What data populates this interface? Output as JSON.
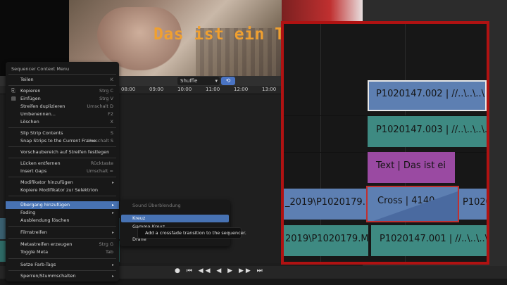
{
  "preview": {
    "overlay_text": "Das ist ein T"
  },
  "toolbar": {
    "snap_mode": "Shuffle"
  },
  "ruler": {
    "ticks": [
      "08:00",
      "09:00",
      "10:00",
      "11:00",
      "12:00",
      "13:00"
    ]
  },
  "context_menu": {
    "title": "Sequencer Context Menu",
    "items": [
      {
        "label": "Teilen",
        "shortcut": "K"
      },
      {
        "label": "Kopieren",
        "shortcut": "Strg C"
      },
      {
        "label": "Einfügen",
        "shortcut": "Strg V"
      },
      {
        "label": "Streifen duplizieren",
        "shortcut": "Umschalt D"
      },
      {
        "label": "Umbenennen...",
        "shortcut": "F2"
      },
      {
        "label": "Löschen",
        "shortcut": "X"
      },
      {
        "label": "Slip Strip Contents",
        "shortcut": "S"
      },
      {
        "label": "Snap Strips to the Current Frame",
        "shortcut": "Umschalt S"
      },
      {
        "label": "Vorschaubereich auf Streifen festlegen",
        "shortcut": ""
      },
      {
        "label": "Lücken entfernen",
        "shortcut": "Rücktaste"
      },
      {
        "label": "Insert Gaps",
        "shortcut": "Umschalt ="
      },
      {
        "label": "Modifikator hinzufügen",
        "shortcut": ""
      },
      {
        "label": "Kopiere Modifikator zur Selektrion",
        "shortcut": ""
      },
      {
        "label": "Übergang hinzufügen",
        "shortcut": ""
      },
      {
        "label": "Fading",
        "shortcut": ""
      },
      {
        "label": "Ausblendung löschen",
        "shortcut": ""
      },
      {
        "label": "Filmstreifen",
        "shortcut": ""
      },
      {
        "label": "Metastreifen erzeugen",
        "shortcut": "Strg G"
      },
      {
        "label": "Toggle Meta",
        "shortcut": "Tab"
      },
      {
        "label": "Setze Farb-Tags",
        "shortcut": ""
      },
      {
        "label": "Sperren/Stummschalten",
        "shortcut": ""
      }
    ]
  },
  "submenu": {
    "items": [
      "Sound Überblendung",
      "Kreuz",
      "Gamma Kreuz",
      "Drane"
    ]
  },
  "tooltip": "Add a crossfade transition to the sequencer.",
  "zoom": {
    "clips": [
      "P1020147.002 | //..\\..\\..\\..\\P",
      "P1020147.003 | //..\\..\\..\\..\\P",
      "Text | Das ist ei",
      "_2019\\P1020179.",
      "Cross | 4140",
      "P1020",
      "2019\\P1020179.M",
      "P1020147.001 | //..\\..\\..\\..\\P"
    ]
  },
  "transport": {
    "controls": "●  ⏮ ◀◀ ◀ ▶ ▶▶ ⏭"
  },
  "colors": {
    "highlight": "#4772b3",
    "zoom_border": "#b01212",
    "title_text": "#f0a030"
  }
}
